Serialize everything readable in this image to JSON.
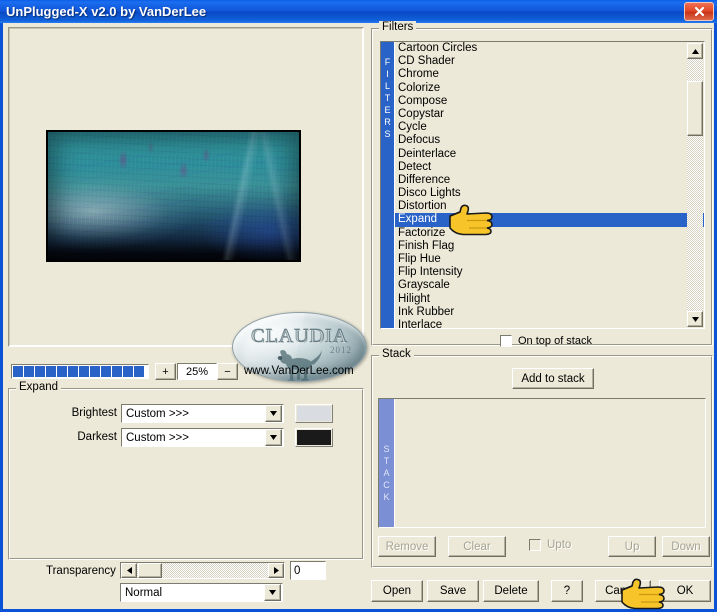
{
  "window": {
    "title": "UnPlugged-X v2.0 by VanDerLee",
    "close_label": "x"
  },
  "preview": {
    "watermark_name": "CLAUDIA",
    "watermark_year": "2012"
  },
  "zoom": {
    "plus_label": "+",
    "minus_label": "−",
    "value": "25%",
    "segments": 12,
    "site_url": "www.VanDerLee.com"
  },
  "expand": {
    "group_label": "Expand",
    "brightest_label": "Brightest",
    "brightest_value": "Custom >>>",
    "brightest_color": "#d9dde1",
    "darkest_label": "Darkest",
    "darkest_value": "Custom >>>",
    "darkest_color": "#1a1a1a"
  },
  "transparency": {
    "label": "Transparency",
    "value": "0",
    "left_arrow": "◄",
    "right_arrow": "►",
    "blend_mode": "Normal"
  },
  "filters": {
    "group_label": "Filters",
    "strip_label": "FILTERS",
    "selected": "Expand",
    "items": [
      "Cartoon Circles",
      "CD Shader",
      "Chrome",
      "Colorize",
      "Compose",
      "Copystar",
      "Cycle",
      "Defocus",
      "Deinterlace",
      "Detect",
      "Difference",
      "Disco Lights",
      "Distortion",
      "Expand",
      "Factorize",
      "Finish Flag",
      "Flip Hue",
      "Flip Intensity",
      "Grayscale",
      "Hilight",
      "Ink Rubber",
      "Interlace"
    ],
    "scroll_up": "▲",
    "scroll_down": "▼",
    "on_top_of_stack_label": "On top of stack",
    "on_top_of_stack_checked": false
  },
  "stack": {
    "group_label": "Stack",
    "strip_label": "STACK",
    "add_label": "Add to stack",
    "items": [],
    "remove_label": "Remove",
    "clear_label": "Clear",
    "upto_label": "Upto",
    "upto_checked": false,
    "up_label": "Up",
    "down_label": "Down"
  },
  "bottom_buttons": {
    "open_label": "Open",
    "save_label": "Save",
    "delete_label": "Delete",
    "help_label": "?",
    "cancel_label": "Cancel",
    "ok_label": "OK"
  },
  "colors": {
    "title_blue": "#1055d8",
    "selection_blue": "#2a63c8",
    "window_bg": "#ece9d8",
    "close_red": "#c9341a"
  }
}
